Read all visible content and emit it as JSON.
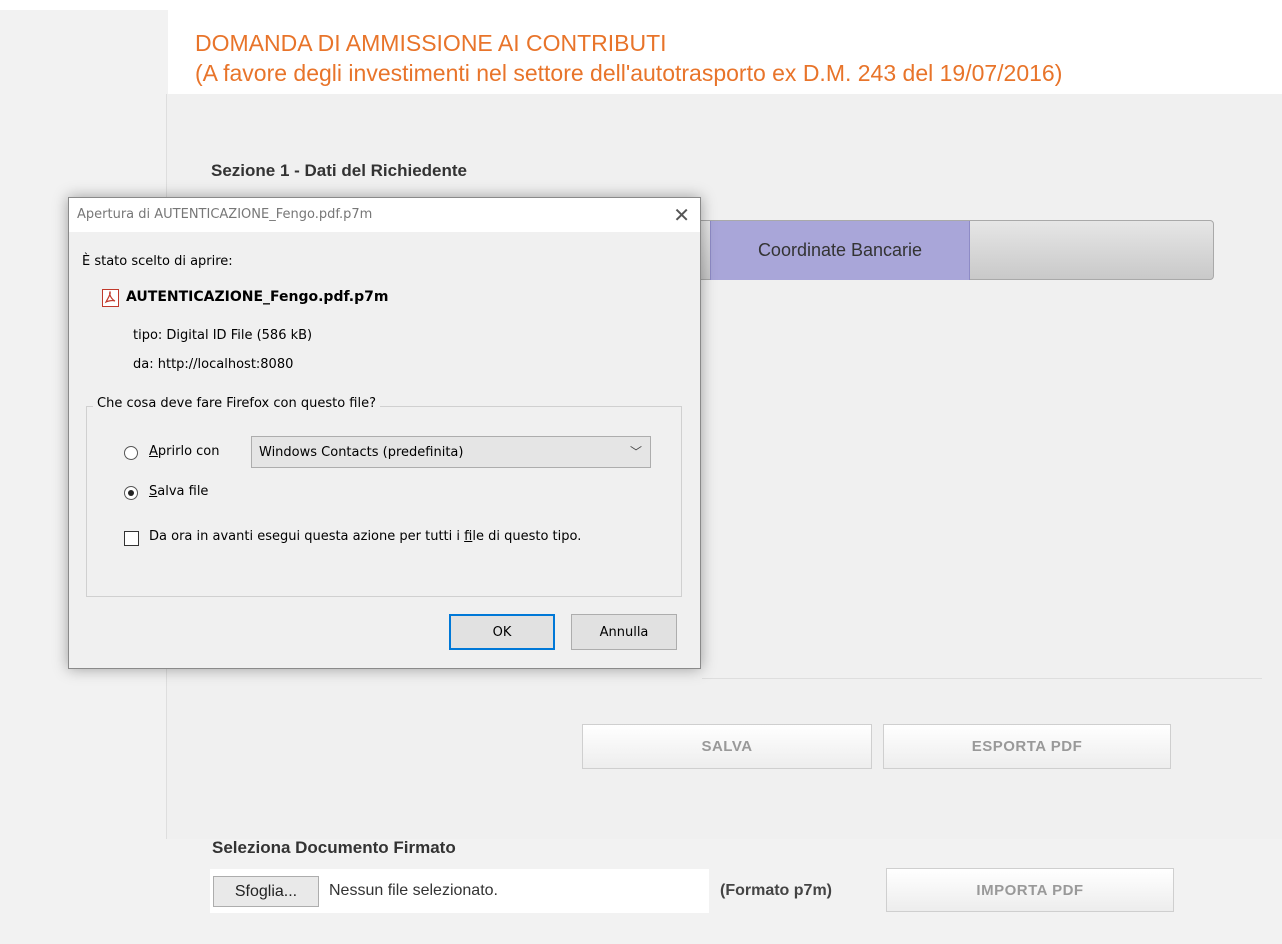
{
  "header": {
    "title": "DOMANDA DI AMMISSIONE AI CONTRIBUTI",
    "subtitle": "(A favore degli investimenti nel settore dell'autotrasporto ex D.M. 243 del 19/07/2016)"
  },
  "section": {
    "title": "Sezione 1 - Dati del Richiedente"
  },
  "tabs": {
    "active_label": "Coordinate Bancarie"
  },
  "actions": {
    "save_label": "SALVA",
    "export_label": "ESPORTA PDF"
  },
  "upload": {
    "label": "Seleziona Documento Firmato",
    "browse_label": "Sfoglia...",
    "no_file_text": "Nessun file selezionato.",
    "format_text": "(Formato p7m)",
    "import_label": "IMPORTA PDF"
  },
  "dialog": {
    "title": "Apertura di AUTENTICAZIONE_Fengo.pdf.p7m",
    "chosen_text": "È stato scelto di aprire:",
    "file_name": "AUTENTICAZIONE_Fengo.pdf.p7m",
    "type_text": "tipo:  Digital ID File (586 kB)",
    "from_text": "da:  http://localhost:8080",
    "question": "Che cosa deve fare Firefox con questo file?",
    "open_with": {
      "first": "A",
      "rest": "prirlo con"
    },
    "app_selected": "Windows Contacts (predefinita)",
    "save_file": {
      "first": "S",
      "rest": "alva file"
    },
    "remember": {
      "before": "Da ora in avanti esegui questa azione per tutti i ",
      "ul": "f",
      "after": "ile di questo tipo."
    },
    "ok_label": "OK",
    "cancel_label": "Annulla",
    "selected_option": "save_file",
    "remember_checked": false
  },
  "colors": {
    "title_orange": "#e8742a",
    "active_tab": "#a9a6d9",
    "focus_blue": "#0078d7"
  },
  "icons": {
    "close": "close-icon",
    "pdf": "pdf-file-icon",
    "dropdown": "chevron-down-icon"
  }
}
